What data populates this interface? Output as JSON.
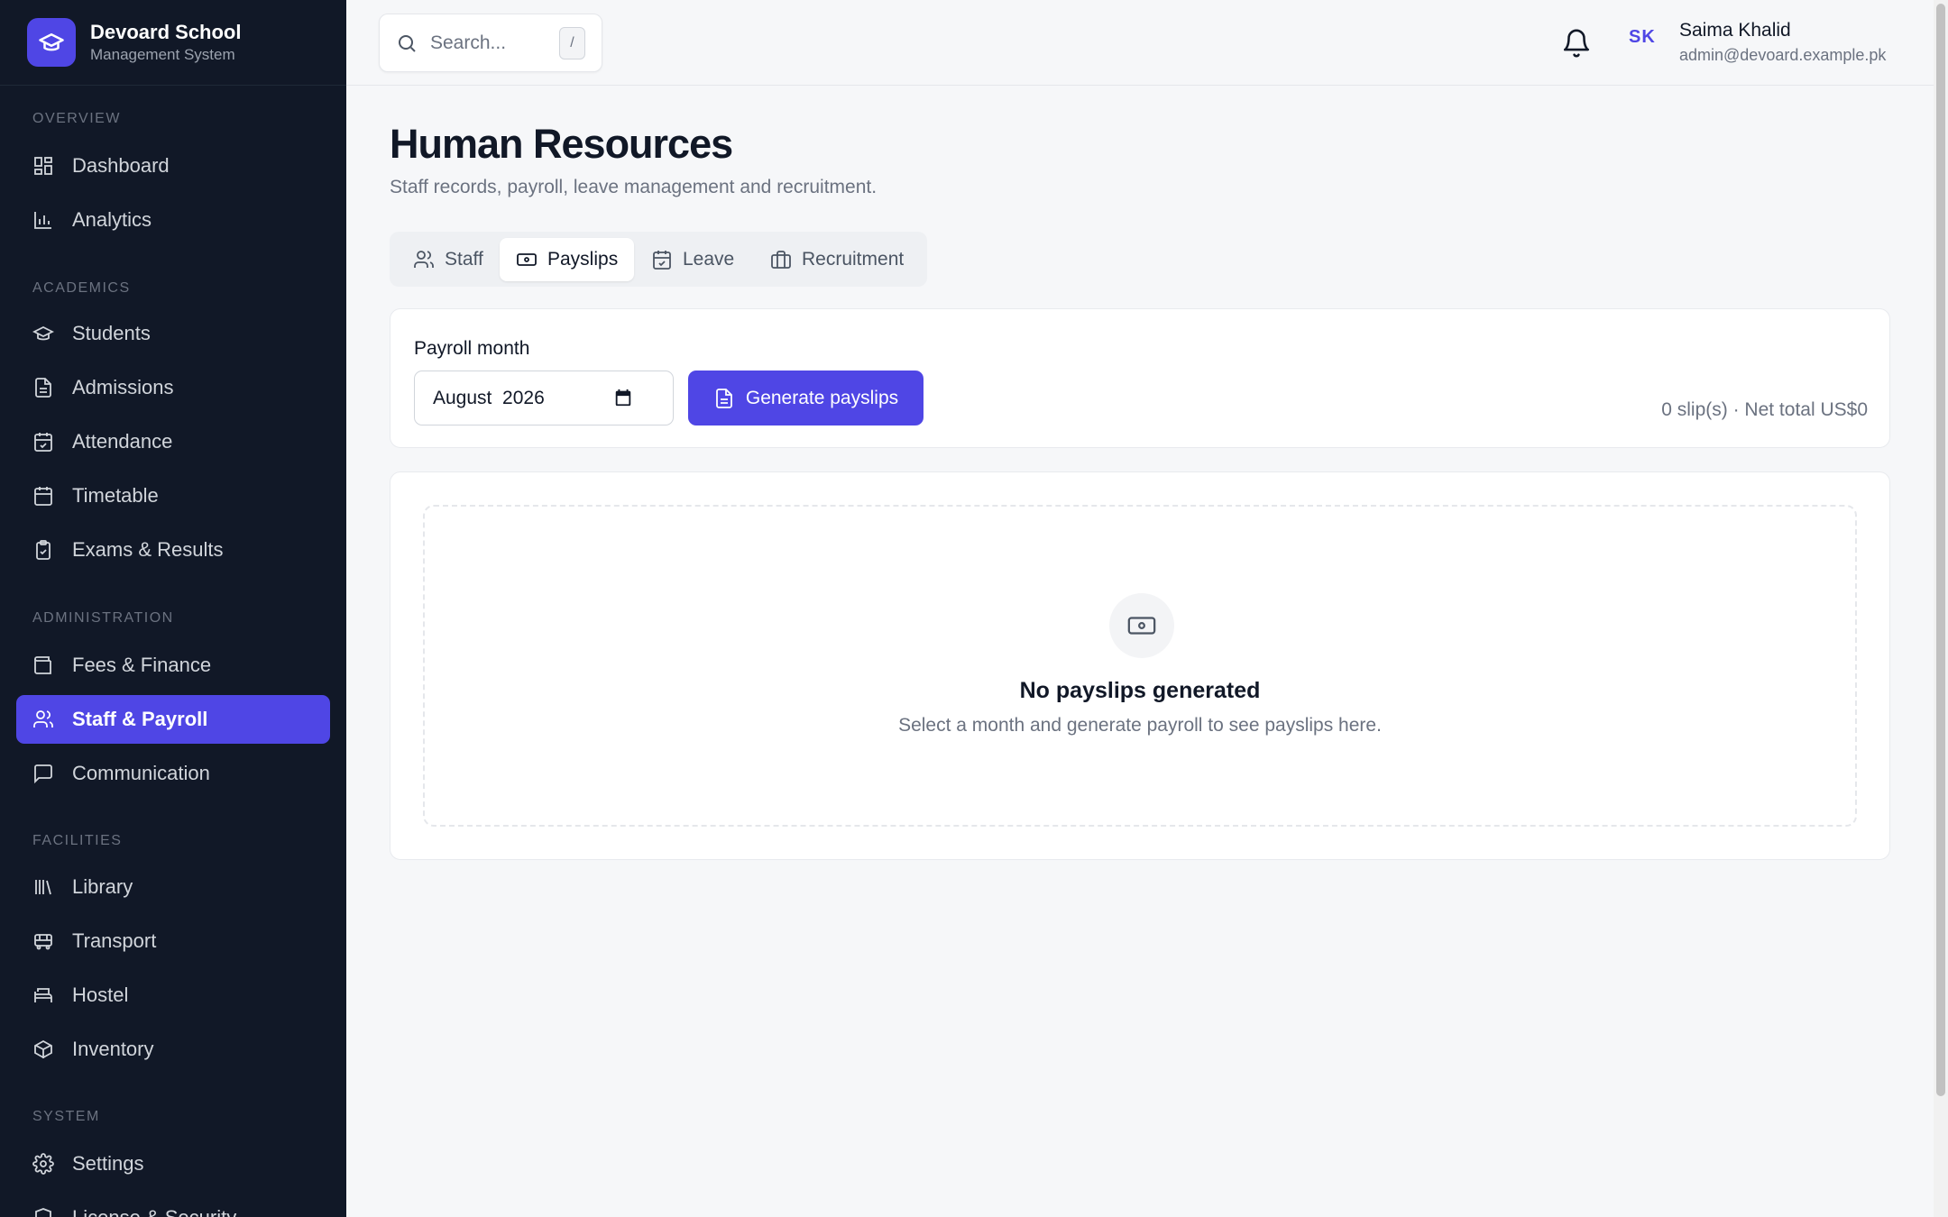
{
  "brand": {
    "name": "Devoard School",
    "subtitle": "Management System",
    "color": "#4f46e5"
  },
  "sidebar": {
    "sections": [
      {
        "title": "Overview",
        "items": [
          {
            "label": "Dashboard",
            "icon": "dashboard-icon"
          },
          {
            "label": "Analytics",
            "icon": "bar-chart-icon"
          }
        ]
      },
      {
        "title": "Academics",
        "items": [
          {
            "label": "Students",
            "icon": "graduation-cap-icon"
          },
          {
            "label": "Admissions",
            "icon": "document-icon"
          },
          {
            "label": "Attendance",
            "icon": "calendar-check-icon"
          },
          {
            "label": "Timetable",
            "icon": "calendar-icon"
          },
          {
            "label": "Exams & Results",
            "icon": "clipboard-check-icon"
          }
        ]
      },
      {
        "title": "Administration",
        "items": [
          {
            "label": "Fees & Finance",
            "icon": "wallet-icon"
          },
          {
            "label": "Staff & Payroll",
            "icon": "users-icon",
            "active": true
          },
          {
            "label": "Communication",
            "icon": "message-icon"
          }
        ]
      },
      {
        "title": "Facilities",
        "items": [
          {
            "label": "Library",
            "icon": "library-icon"
          },
          {
            "label": "Transport",
            "icon": "bus-icon"
          },
          {
            "label": "Hostel",
            "icon": "bed-icon"
          },
          {
            "label": "Inventory",
            "icon": "package-icon"
          }
        ]
      },
      {
        "title": "System",
        "items": [
          {
            "label": "Settings",
            "icon": "gear-icon"
          },
          {
            "label": "License & Security",
            "icon": "shield-icon"
          }
        ]
      }
    ]
  },
  "topbar": {
    "search_placeholder": "Search...",
    "search_shortcut": "/",
    "user": {
      "initials": "SK",
      "name": "Saima Khalid",
      "email": "admin@devoard.example.pk"
    }
  },
  "page": {
    "title": "Human Resources",
    "subtitle": "Staff records, payroll, leave management and recruitment."
  },
  "tabs": [
    {
      "label": "Staff",
      "icon": "users-icon"
    },
    {
      "label": "Payslips",
      "icon": "banknote-icon",
      "active": true
    },
    {
      "label": "Leave",
      "icon": "calendar-check-icon"
    },
    {
      "label": "Recruitment",
      "icon": "briefcase-icon"
    }
  ],
  "payroll": {
    "month_label": "Payroll month",
    "month_value": "August  2026",
    "generate_label": "Generate payslips",
    "summary": "0 slip(s) · Net total US$0"
  },
  "empty_state": {
    "title": "No payslips generated",
    "message": "Select a month and generate payroll to see payslips here."
  }
}
